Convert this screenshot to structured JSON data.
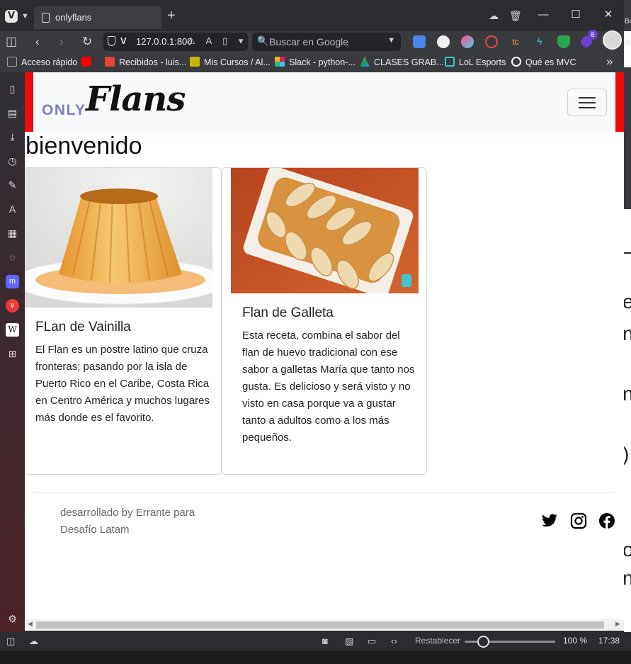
{
  "browser": {
    "tab_title": "onlyflans",
    "url": "127.0.0.1:800",
    "search_placeholder": "Buscar en Google",
    "extension_badge": "8"
  },
  "bookmarks": [
    {
      "label": "Acceso rápido",
      "color": "#9aa0a6"
    },
    {
      "label": "",
      "color": "#ff0000"
    },
    {
      "label": "Recibidos - luis...",
      "color": "#ea4335"
    },
    {
      "label": "Mis Cursos / Al...",
      "color": "#c8b400"
    },
    {
      "label": "Slack - python-...",
      "color": "#e01e5a"
    },
    {
      "label": "CLASES GRAB...",
      "color": "#f4b400"
    },
    {
      "label": "LoL Esports",
      "color": "#36c6c0"
    },
    {
      "label": "Qué es MVC",
      "color": "#ffffff"
    }
  ],
  "site": {
    "brand_only": "ONLY",
    "brand_flans": "Flans",
    "welcome": "bienvenido",
    "cards": [
      {
        "title": "FLan de Vainilla",
        "text": "El Flan es un postre latino que cruza fronteras; pasando por la isla de Puerto Rico en el Caribe, Costa Rica en Centro América y muchos lugares más donde es el favorito."
      },
      {
        "title": "Flan de Galleta",
        "text": "Esta receta, combina el sabor del flan de huevo tradicional con ese sabor a galletas María que tanto nos gusta. Es delicioso y será visto y no visto en casa porque va a gustar tanto a adultos como a los más pequeños."
      }
    ],
    "footer_text": "desarrollado by Errante para Desafío Latam",
    "social": [
      "twitter-icon",
      "instagram-icon",
      "facebook-icon"
    ]
  },
  "background_window_glyphs": [
    "Bo",
    "ol",
    "e",
    "n,",
    "n",
    ")",
    "o",
    "n"
  ],
  "statusbar": {
    "reset_label": "Restablecer",
    "zoom": "100 %",
    "clock": "17:38"
  }
}
